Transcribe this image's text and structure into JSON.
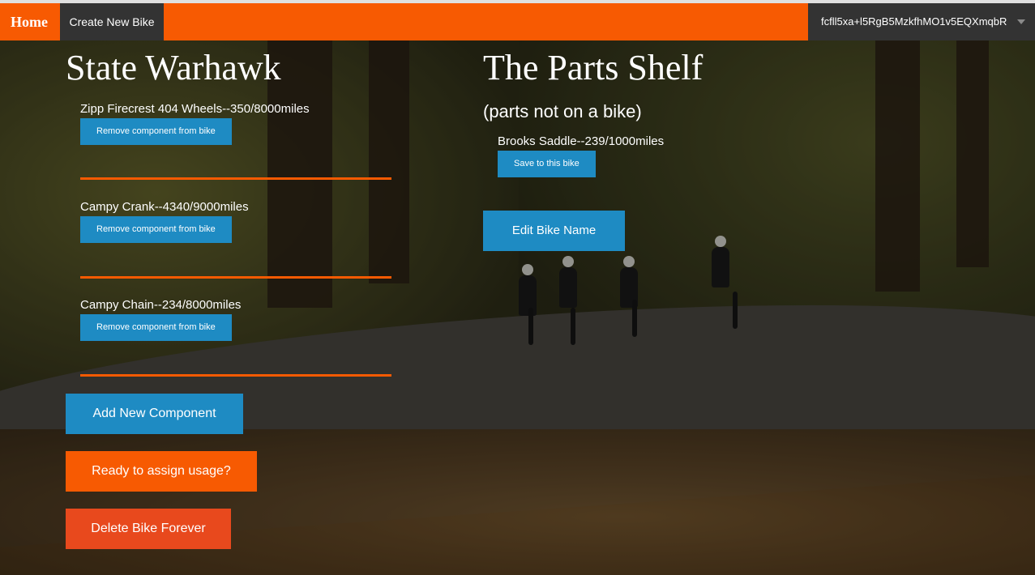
{
  "navbar": {
    "home": "Home",
    "create": "Create New Bike",
    "user": "fcfll5xa+l5RgB5MzkfhMO1v5EQXmqbR"
  },
  "bike": {
    "name": "State Warhawk",
    "components": [
      {
        "label": "Zipp Firecrest 404 Wheels--350/8000miles",
        "button": "Remove component from bike"
      },
      {
        "label": "Campy Crank--4340/9000miles",
        "button": "Remove component from bike"
      },
      {
        "label": "Campy Chain--234/8000miles",
        "button": "Remove component from bike"
      }
    ],
    "add_button": "Add New Component",
    "assign_button": "Ready to assign usage?",
    "delete_button": "Delete Bike Forever"
  },
  "shelf": {
    "title": "The Parts Shelf",
    "subtitle": "(parts not on a bike)",
    "parts": [
      {
        "label": "Brooks Saddle--239/1000miles",
        "button": "Save to this bike"
      }
    ],
    "edit_button": "Edit Bike Name"
  },
  "colors": {
    "navbar": "#f75a02",
    "nav_dark": "#333333",
    "primary_button": "#1e8bc3",
    "assign_button": "#f75a02",
    "delete_button": "#e8491d",
    "divider": "#f75a02"
  },
  "icons": {
    "user_menu": "caret-down-icon"
  }
}
